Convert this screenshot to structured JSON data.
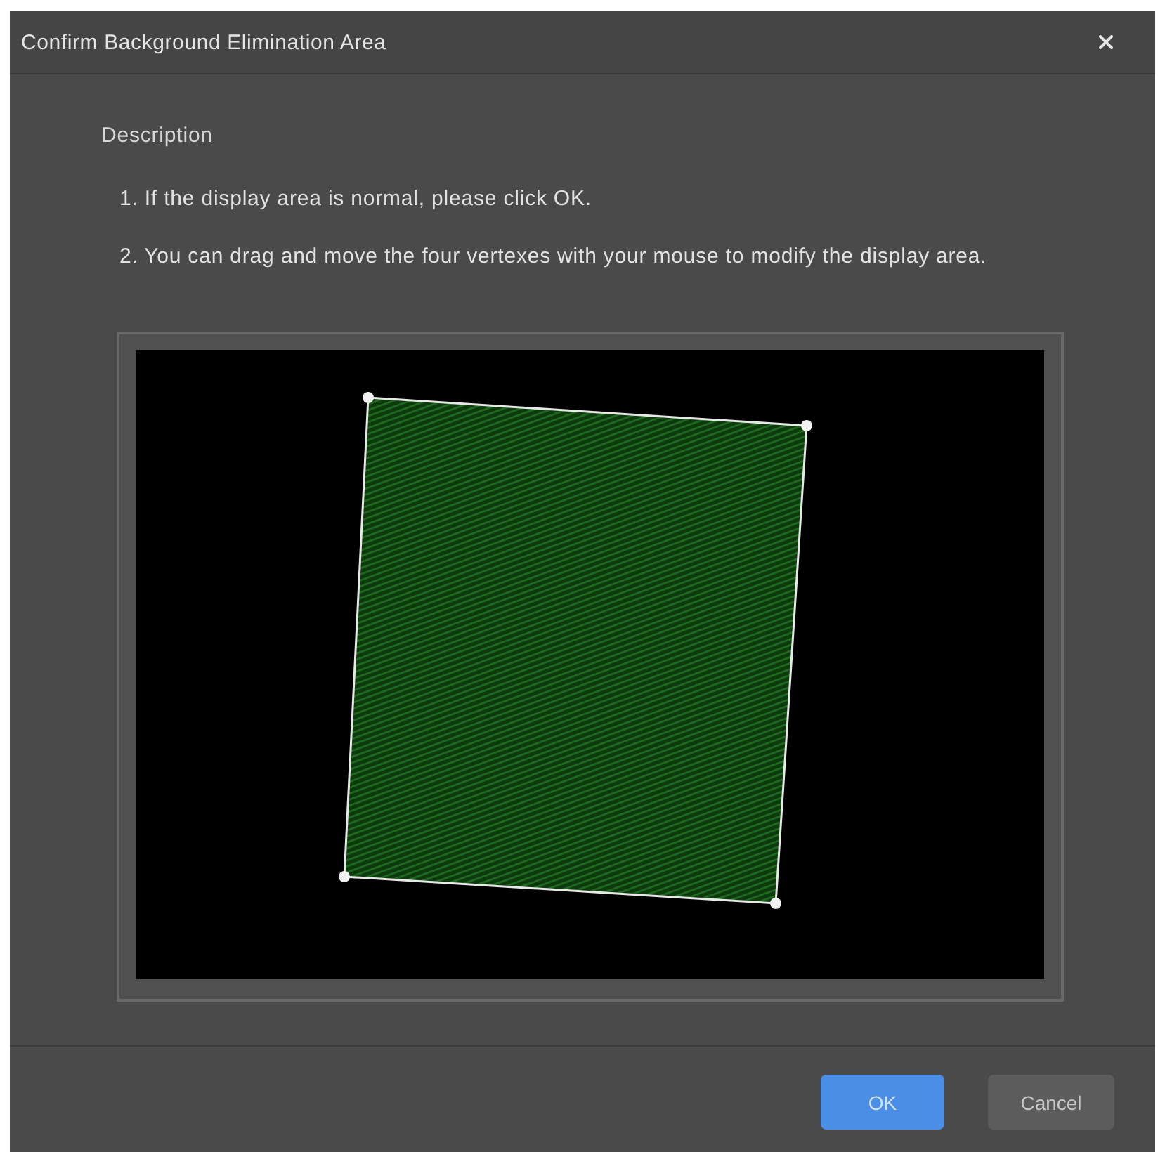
{
  "dialog": {
    "title": "Confirm Background Elimination Area"
  },
  "description": {
    "heading": "Description",
    "steps": [
      "1. If the display area is normal, please click OK.",
      "2. You can drag and move the four vertexes with your mouse to modify the display area."
    ]
  },
  "buttons": [
    {
      "label": "OK",
      "kind": "primary"
    },
    {
      "label": "Cancel",
      "kind": "secondary"
    }
  ]
}
